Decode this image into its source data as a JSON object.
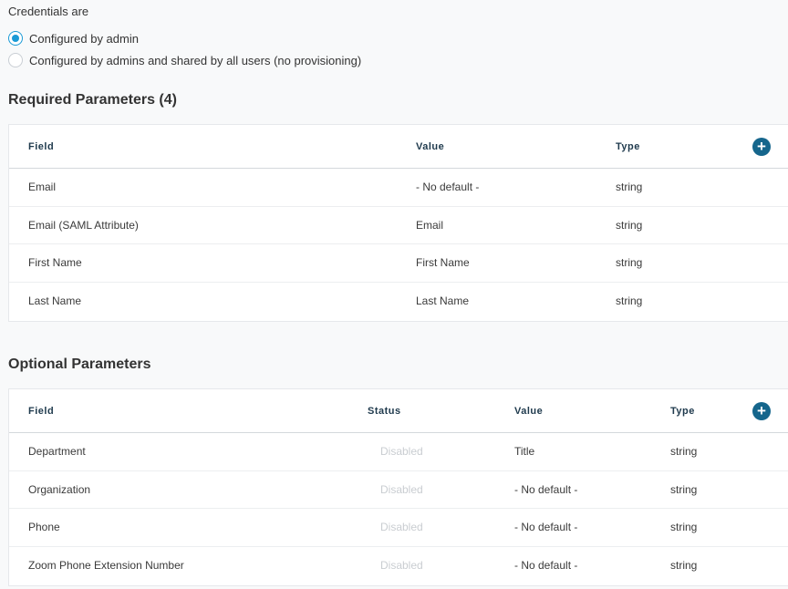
{
  "credentials": {
    "label": "Credentials are",
    "options": [
      {
        "label": "Configured by admin",
        "selected": true
      },
      {
        "label": "Configured by admins and shared by all users (no provisioning)",
        "selected": false
      }
    ]
  },
  "required": {
    "title": "Required Parameters (4)",
    "headers": {
      "field": "Field",
      "value": "Value",
      "type": "Type"
    },
    "add_icon": "+",
    "rows": [
      {
        "field": "Email",
        "value": "- No default -",
        "type": "string"
      },
      {
        "field": "Email (SAML Attribute)",
        "value": "Email",
        "type": "string"
      },
      {
        "field": "First Name",
        "value": "First Name",
        "type": "string"
      },
      {
        "field": "Last Name",
        "value": "Last Name",
        "type": "string"
      }
    ]
  },
  "optional": {
    "title": "Optional Parameters",
    "headers": {
      "field": "Field",
      "status": "Status",
      "value": "Value",
      "type": "Type"
    },
    "add_icon": "+",
    "rows": [
      {
        "field": "Department",
        "status": "Disabled",
        "value": "Title",
        "type": "string"
      },
      {
        "field": "Organization",
        "status": "Disabled",
        "value": "- No default -",
        "type": "string"
      },
      {
        "field": "Phone",
        "status": "Disabled",
        "value": "- No default -",
        "type": "string"
      },
      {
        "field": "Zoom Phone Extension Number",
        "status": "Disabled",
        "value": "- No default -",
        "type": "string"
      }
    ]
  },
  "colors": {
    "accent": "#1a9ad6",
    "add_button": "#15668c",
    "disabled_text": "#c9cdd1"
  }
}
